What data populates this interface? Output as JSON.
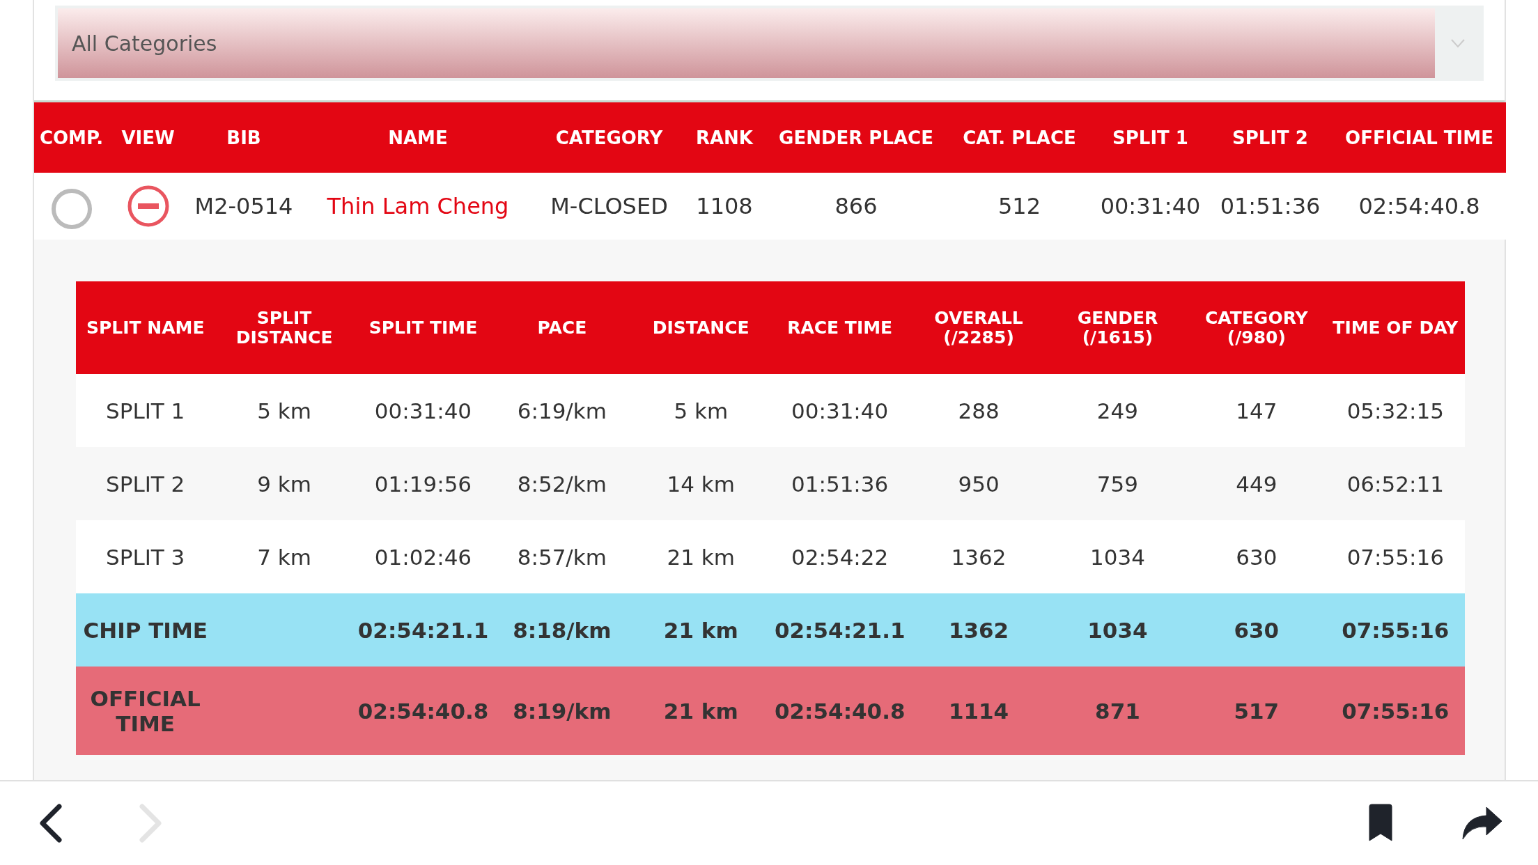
{
  "category_select": {
    "value": "All Categories"
  },
  "results": {
    "columns": [
      "COMP.",
      "VIEW",
      "BIB",
      "NAME",
      "CATEGORY",
      "RANK",
      "GENDER PLACE",
      "CAT. PLACE",
      "SPLIT 1",
      "SPLIT 2",
      "OFFICIAL TIME"
    ],
    "rows": [
      {
        "compared": false,
        "expanded": true,
        "bib": "M2-0514",
        "name": "Thin Lam Cheng",
        "category": "M-CLOSED",
        "rank": "1108",
        "gender_place": "866",
        "cat_place": "512",
        "split_1": "00:31:40",
        "split_2": "01:51:36",
        "official_time": "02:54:40.8"
      }
    ]
  },
  "splits": {
    "columns": [
      "SPLIT NAME",
      "SPLIT\nDISTANCE",
      "SPLIT TIME",
      "PACE",
      "DISTANCE",
      "RACE TIME",
      "OVERALL\n(/2285)",
      "GENDER\n(/1615)",
      "CATEGORY\n(/980)",
      "TIME OF DAY"
    ],
    "rows": [
      {
        "kind": "split",
        "cells": [
          "SPLIT 1",
          "5 km",
          "00:31:40",
          "6:19/km",
          "5 km",
          "00:31:40",
          "288",
          "249",
          "147",
          "05:32:15"
        ]
      },
      {
        "kind": "split",
        "cells": [
          "SPLIT 2",
          "9 km",
          "01:19:56",
          "8:52/km",
          "14 km",
          "01:51:36",
          "950",
          "759",
          "449",
          "06:52:11"
        ]
      },
      {
        "kind": "split",
        "cells": [
          "SPLIT 3",
          "7 km",
          "01:02:46",
          "8:57/km",
          "21 km",
          "02:54:22",
          "1362",
          "1034",
          "630",
          "07:55:16"
        ]
      },
      {
        "kind": "chip",
        "cells": [
          "CHIP TIME",
          "",
          "02:54:21.1",
          "8:18/km",
          "21 km",
          "02:54:21.1",
          "1362",
          "1034",
          "630",
          "07:55:16"
        ]
      },
      {
        "kind": "official",
        "cells": [
          "OFFICIAL TIME",
          "",
          "02:54:40.8",
          "8:19/km",
          "21 km",
          "02:54:40.8",
          "1114",
          "871",
          "517",
          "07:55:16"
        ]
      }
    ]
  },
  "navigation": {
    "back_enabled": true,
    "forward_enabled": false
  }
}
